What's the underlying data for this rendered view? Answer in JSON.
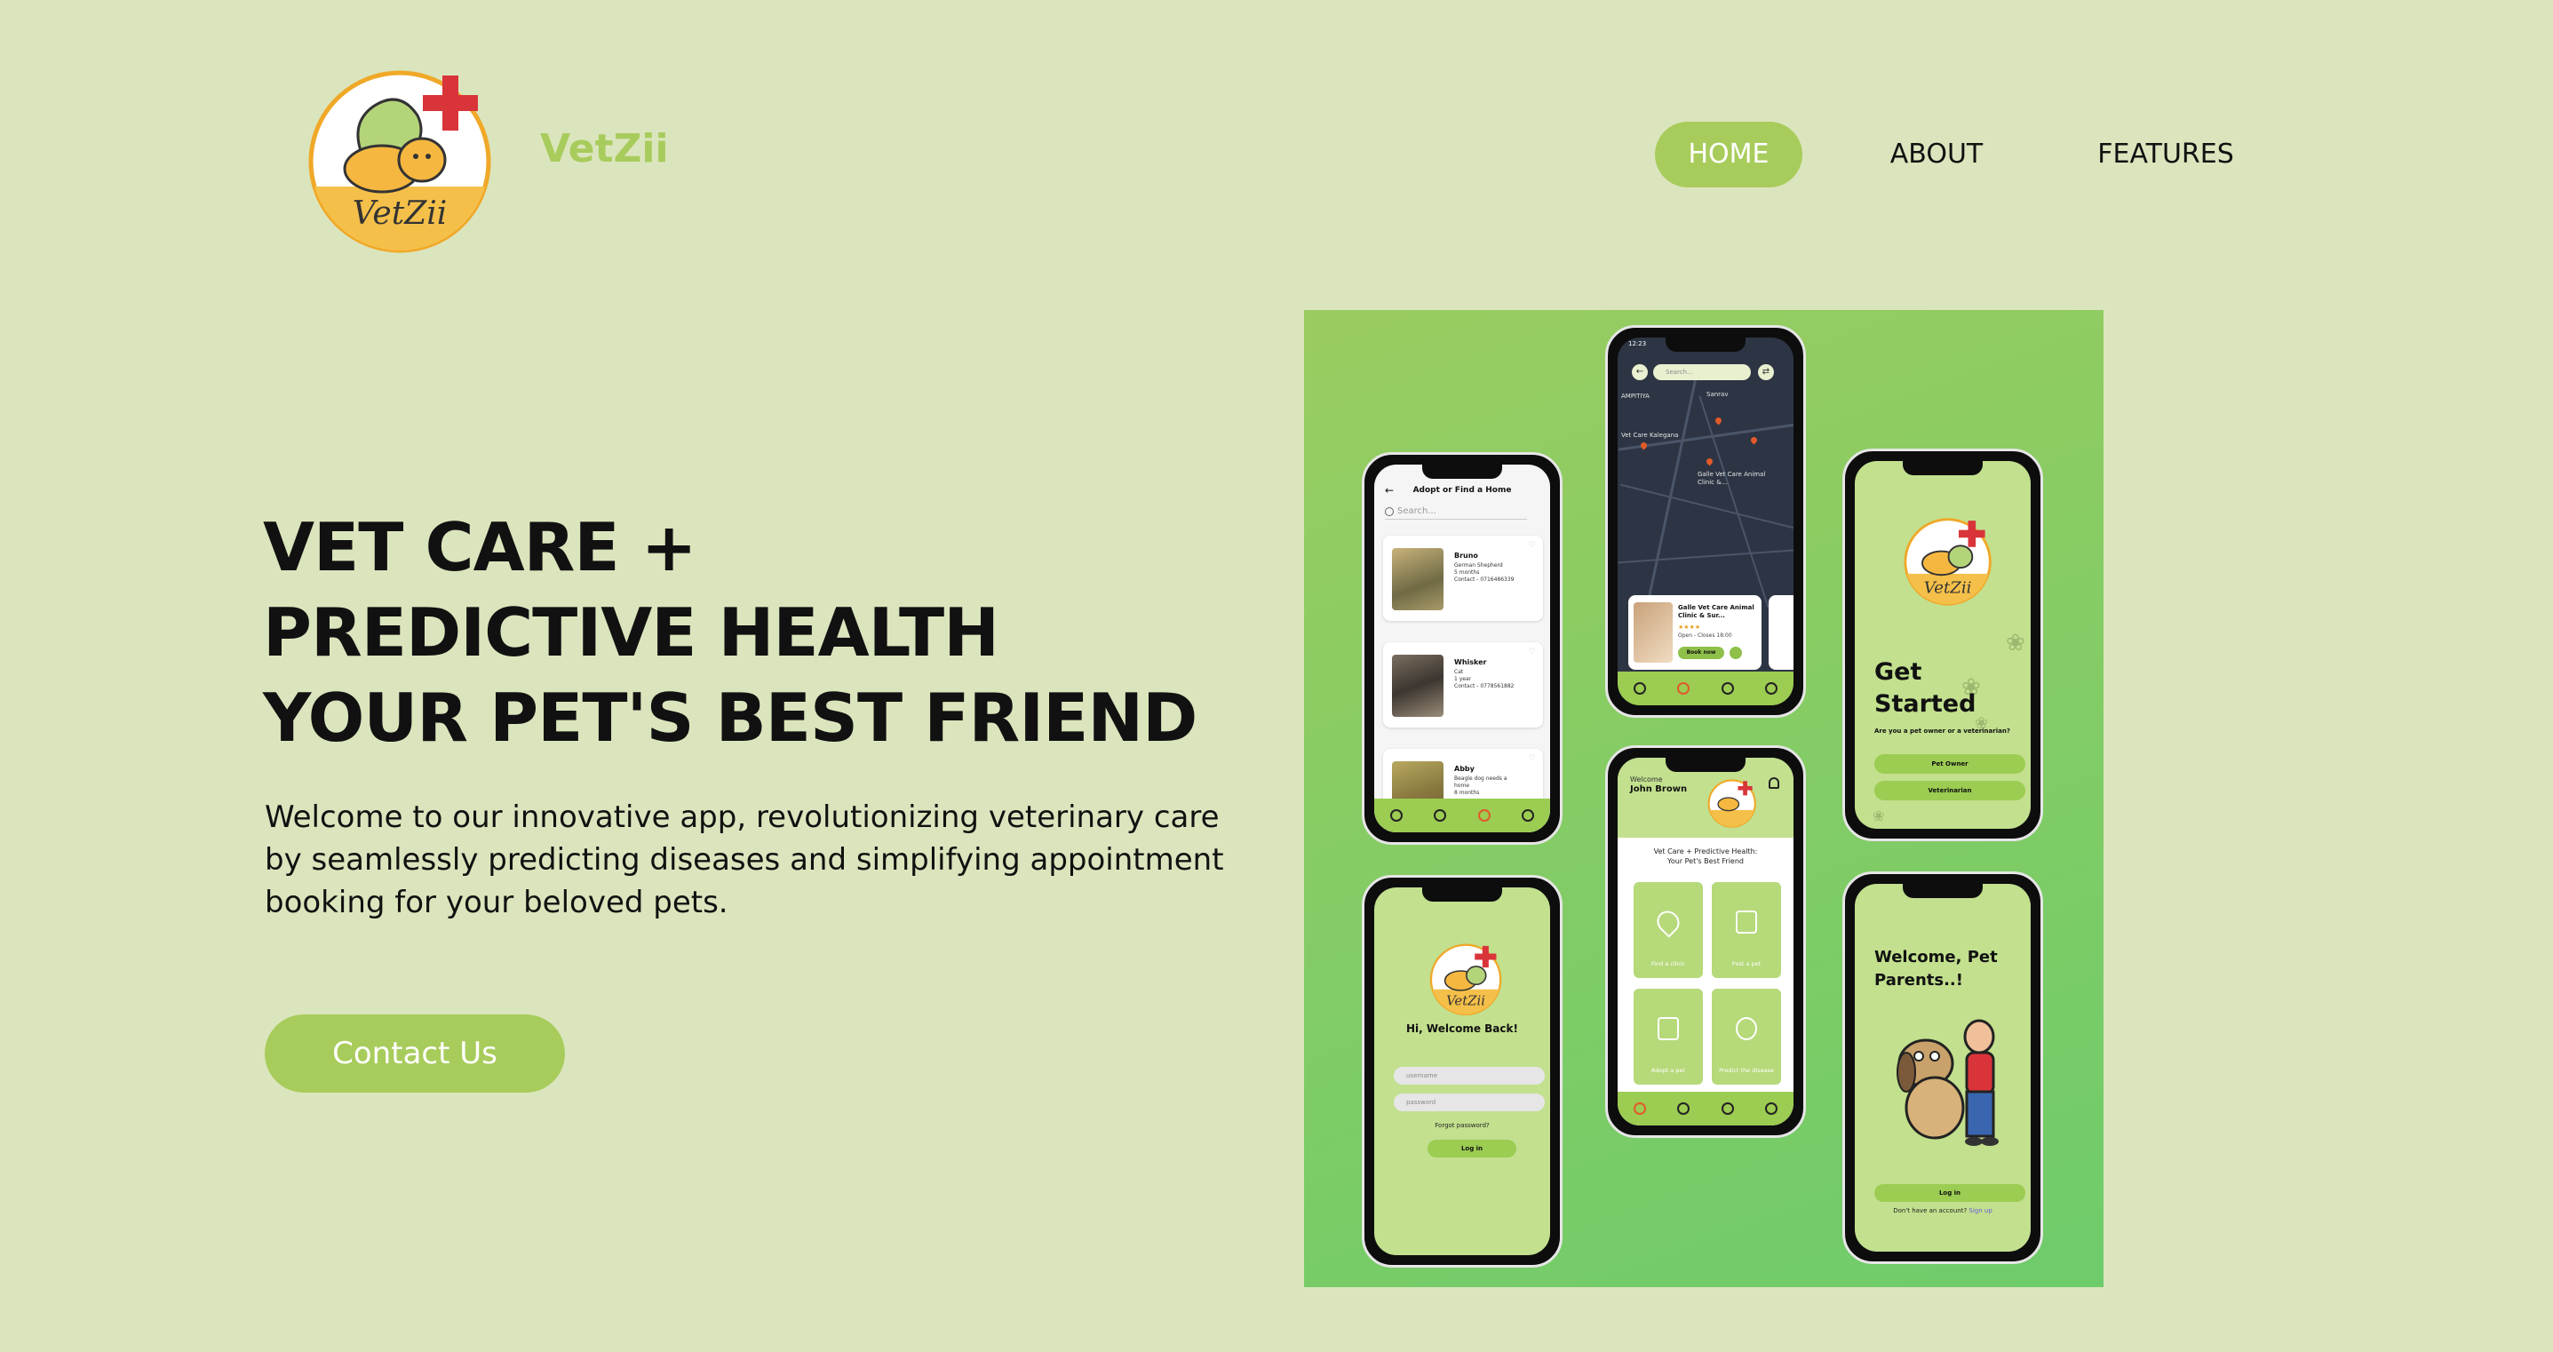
{
  "brand": {
    "name": "VetZii",
    "logo_text": "VetZii"
  },
  "nav": [
    {
      "label": "HOME",
      "active": true
    },
    {
      "label": "ABOUT",
      "active": false
    },
    {
      "label": "FEATURES",
      "active": false
    }
  ],
  "hero": {
    "headline_lines": [
      "VET CARE +",
      "PREDICTIVE HEALTH",
      "YOUR PET'S BEST FRIEND"
    ],
    "intro": "Welcome to our innovative app, revolutionizing veterinary care by seamlessly predicting diseases and simplifying appointment booking for your beloved pets.",
    "cta": "Contact Us"
  },
  "mockups": {
    "adopt": {
      "title": "Adopt or Find a Home",
      "search_placeholder": "Search...",
      "pets": [
        {
          "name": "Bruno",
          "lines": [
            "German Shepherd",
            "5 months",
            "Contact - 0716486339"
          ]
        },
        {
          "name": "Whisker",
          "lines": [
            "Cat",
            "1 year",
            "Contact - 0778561882"
          ]
        },
        {
          "name": "Abby",
          "lines": [
            "Beagle dog needs a",
            "home",
            "8 months"
          ]
        }
      ]
    },
    "map": {
      "time": "12:23",
      "search_placeholder": "Search...",
      "labels": [
        "AMPITIYA",
        "Sanrav",
        "Vet Care Kalegana",
        "Galle Vet Care Animal Clinic &..."
      ],
      "clinic": {
        "name": "Galle Vet Care Animal Clinic & Sur...",
        "stars": "★★★★",
        "hours": "Open - Closes 18:00",
        "book": "Book now"
      }
    },
    "start": {
      "title_line1": "Get",
      "title_line2": "Started",
      "question": "Are you a pet owner or a veterinarian?",
      "owner_btn": "Pet Owner",
      "vet_btn": "Veterinarian"
    },
    "login": {
      "greeting": "Hi, Welcome Back!",
      "username_placeholder": "username",
      "password_placeholder": "password",
      "forgot": "Forgot password?",
      "login_btn": "Log in"
    },
    "home": {
      "welcome": "Welcome",
      "user": "John Brown",
      "tagline_1": "Vet Care + Predictive Health:",
      "tagline_2": "Your Pet's Best Friend",
      "tiles": [
        "Find a clinic",
        "Post a pet",
        "Adopt a pet",
        "Predict the disease"
      ]
    },
    "welcome": {
      "title_line1": "Welcome, Pet",
      "title_line2": "Parents..!",
      "login_btn": "Log in",
      "no_account": "Don't have an account?",
      "signup": "Sign up"
    }
  },
  "colors": {
    "background": "#dbe5bd",
    "accent": "#a8cc5c",
    "showcase_top": "#99cc60",
    "showcase_bottom": "#6ecc6a",
    "plus": "#d9343a"
  }
}
